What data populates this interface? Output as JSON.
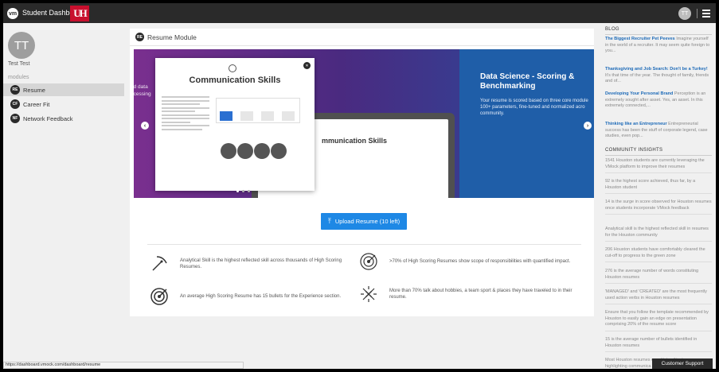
{
  "app": {
    "logo_text": "vm",
    "title": "Student Dashboard",
    "uh_logo": "UH"
  },
  "user": {
    "initials": "TT",
    "name": "Test Test"
  },
  "sidebar": {
    "modules_label": "modules",
    "items": [
      {
        "badge": "RE",
        "label": "Resume",
        "active": true
      },
      {
        "badge": "CF",
        "label": "Career Fit"
      },
      {
        "badge": "NF",
        "label": "Network Feedback"
      }
    ]
  },
  "module": {
    "badge": "RE",
    "title": "Resume Module",
    "carousel": {
      "left_partial_text": "ed data\nocessing",
      "modal_title": "Communication Skills",
      "ghost_title": "mmunication Skills",
      "right_title": "Data Science - Scoring & Benchmarking",
      "right_text": "Your resume is scored based on three core module\n100+ parameters, fine-tuned and normalized acro\ncommunity.",
      "prev_icon": "chevron-left",
      "next_icon": "chevron-right"
    },
    "upload_button": "Upload Resume (10 left)",
    "insights": [
      {
        "icon": "pickaxe-icon",
        "text": "Analytical Skill is the highest reflected skill across thousands of High Scoring Resumes."
      },
      {
        "icon": "target-badge-icon",
        "text": ">70% of High Scoring Resumes show scope of responsibilities with quantified impact."
      },
      {
        "icon": "dartboard-icon",
        "text": "An average High Scoring Resume has 15 bullets for the Experience section."
      },
      {
        "icon": "sparkle-badge-icon",
        "text": "More than 70% talk about hobbies, a team sport & places they have traveled to in their resume."
      }
    ]
  },
  "blog": {
    "heading": "BLOG",
    "posts": [
      {
        "title": "The Biggest Recruiter Pet Peeves",
        "excerpt": " Imagine yourself in the world of a recruiter. It may seem quite foreign to you..."
      },
      {
        "title": "Thanksgiving and Job Search: Don't be a Turkey!",
        "excerpt": " It's that time of the year. The thought of family, friends and of..."
      },
      {
        "title": "Developing Your Personal Brand",
        "excerpt": " Perception is an extremely sought after asset. Yes, an asset. In this extremely connected,..."
      },
      {
        "title": "Thinking like an Entrepreneur",
        "excerpt": " Entrepreneurial success has been the stuff of corporate legend, case studies, even pop..."
      }
    ]
  },
  "community": {
    "heading": "COMMUNITY INSIGHTS",
    "items": [
      "1541 Houston students are currently leveraging the VMock platform to improve their resumes",
      "92 is the highest score achieved, thus far, by a Houston student",
      "14 is the surge in score observed for Houston resumes once students incorporate VMock feedback",
      "Analytical skill is the highest reflected skill in resumes for the Houston community",
      "206 Houston students have comfortably cleared the cut-off to progress to the green zone",
      "276 is the average number of words constituting Houston resumes",
      "'MANAGED' and 'CREATED' are the most frequently used action verbs in Houston resumes",
      "Ensure that you follow the template recommended by Houston to easily gain an edge on presentation comprising 20% of the resume score",
      "15 is the average number of bullets identified in Houston resumes",
      "Most Houston resumes constitute of instances highlighting communica experiences"
    ]
  },
  "status_url": "https://dashboard.vmock.com/dashboard/resume",
  "support_button": "Customer Support"
}
